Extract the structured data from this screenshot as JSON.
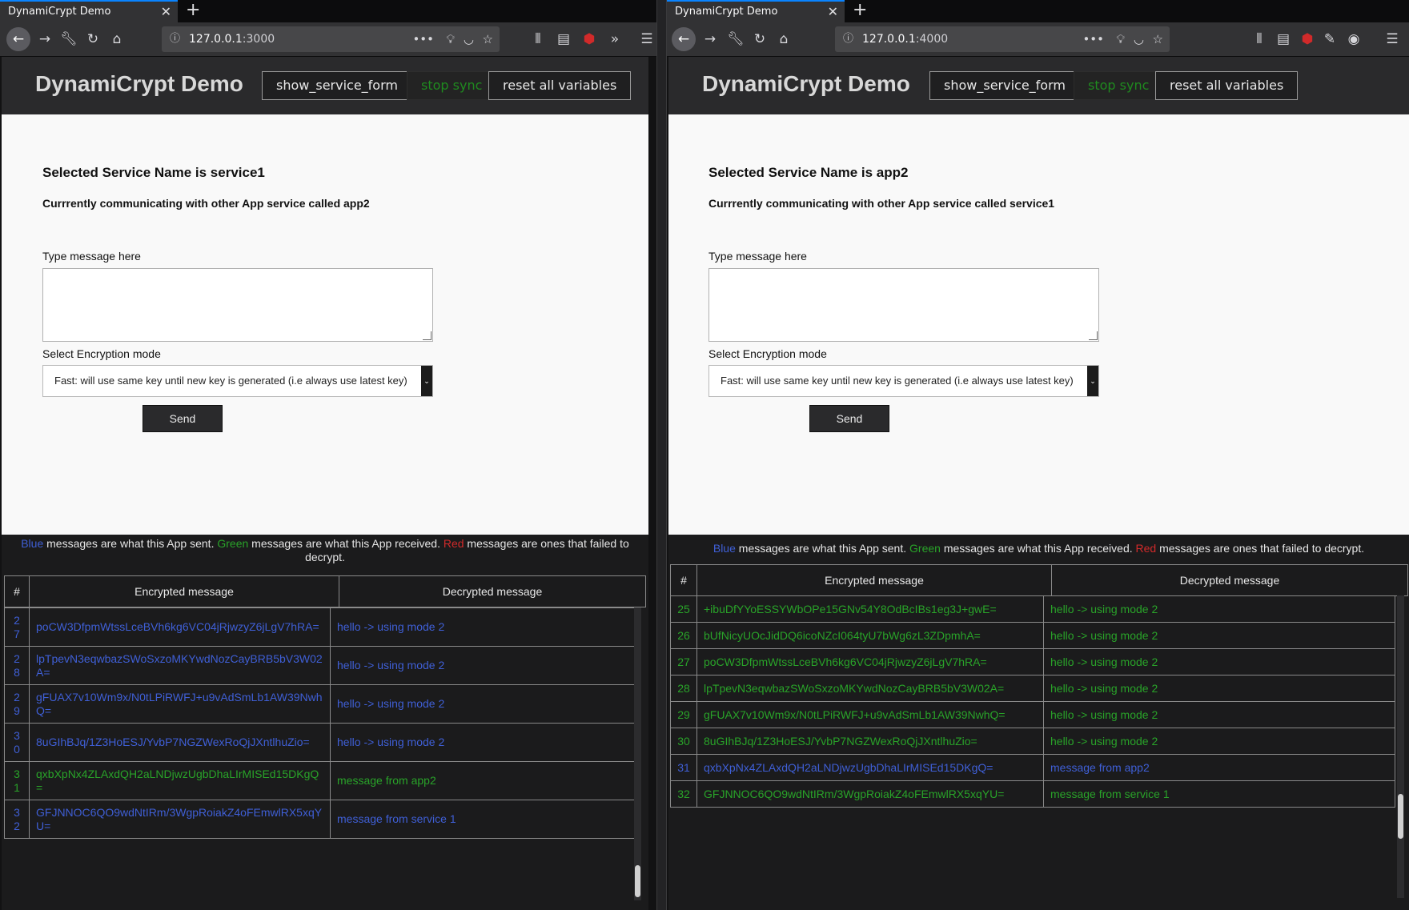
{
  "left": {
    "tab_title": "DynamiCrypt Demo",
    "url_host": "127.0.0.1",
    "url_port": ":3000",
    "app_title": "DynamiCrypt Demo",
    "buttons": {
      "show_service_form": "show_service_form",
      "stop_sync": "stop sync",
      "reset": "reset all variables"
    },
    "selected_service": "Selected Service Name is service1",
    "communicating": "Currrently communicating with other App service called app2",
    "type_label": "Type message here",
    "mode_label": "Select Encryption mode",
    "mode_value": "Fast: will use same key until new key is generated (i.e always use latest key)",
    "send_label": "Send",
    "legend": {
      "blue": "Blue",
      "t1": " messages are what this App sent. ",
      "green": "Green",
      "t2": " messages are what this App received. ",
      "red": "Red",
      "t3": " messages are ones that failed to decrypt."
    },
    "columns": [
      "#",
      "Encrypted message",
      "Decrypted message"
    ],
    "rows": [
      {
        "n": "27",
        "enc": "poCW3DfpmWtssLceBVh6kg6VC04jRjwzyZ6jLgV7hRA=",
        "dec": "hello -> using mode 2",
        "kind": "sent"
      },
      {
        "n": "28",
        "enc": "lpTpevN3eqwbazSWoSxzoMKYwdNozCayBRB5bV3W02A=",
        "dec": "hello -> using mode 2",
        "kind": "sent"
      },
      {
        "n": "29",
        "enc": "gFUAX7v10Wm9x/N0tLPiRWFJ+u9vAdSmLb1AW39NwhQ=",
        "dec": "hello -> using mode 2",
        "kind": "sent"
      },
      {
        "n": "30",
        "enc": "8uGIhBJq/1Z3HoESJ/YvbP7NGZWexRoQjJXntlhuZio=",
        "dec": "hello -> using mode 2",
        "kind": "sent"
      },
      {
        "n": "31",
        "enc": "qxbXpNx4ZLAxdQH2aLNDjwzUgbDhaLIrMISEd15DKgQ=",
        "dec": "message from app2",
        "kind": "recv"
      },
      {
        "n": "32",
        "enc": "GFJNNOC6QO9wdNtIRm/3WgpRoiakZ4oFEmwlRX5xqYU=",
        "dec": "message from service 1",
        "kind": "sent"
      }
    ]
  },
  "right": {
    "tab_title": "DynamiCrypt Demo",
    "url_host": "127.0.0.1",
    "url_port": ":4000",
    "app_title": "DynamiCrypt Demo",
    "buttons": {
      "show_service_form": "show_service_form",
      "stop_sync": "stop sync",
      "reset": "reset all variables"
    },
    "selected_service": "Selected Service Name is app2",
    "communicating": "Currrently communicating with other App service called service1",
    "type_label": "Type message here",
    "mode_label": "Select Encryption mode",
    "mode_value": "Fast: will use same key until new key is generated (i.e always use latest key)",
    "send_label": "Send",
    "legend": {
      "blue": "Blue",
      "t1": " messages are what this App sent. ",
      "green": "Green",
      "t2": " messages are what this App received. ",
      "red": "Red",
      "t3": " messages are ones that failed to decrypt."
    },
    "columns": [
      "#",
      "Encrypted message",
      "Decrypted message"
    ],
    "rows": [
      {
        "n": "25",
        "enc": "+ibuDfYYoESSYWbOPe15GNv54Y8OdBcIBs1eg3J+gwE=",
        "dec": "hello -> using mode 2",
        "kind": "recv"
      },
      {
        "n": "26",
        "enc": "bUfNicyUOcJidDQ6icoNZcI064tyU7bWg6zL3ZDpmhA=",
        "dec": "hello -> using mode 2",
        "kind": "recv"
      },
      {
        "n": "27",
        "enc": "poCW3DfpmWtssLceBVh6kg6VC04jRjwzyZ6jLgV7hRA=",
        "dec": "hello -> using mode 2",
        "kind": "recv"
      },
      {
        "n": "28",
        "enc": "lpTpevN3eqwbazSWoSxzoMKYwdNozCayBRB5bV3W02A=",
        "dec": "hello -> using mode 2",
        "kind": "recv"
      },
      {
        "n": "29",
        "enc": "gFUAX7v10Wm9x/N0tLPiRWFJ+u9vAdSmLb1AW39NwhQ=",
        "dec": "hello -> using mode 2",
        "kind": "recv"
      },
      {
        "n": "30",
        "enc": "8uGIhBJq/1Z3HoESJ/YvbP7NGZWexRoQjJXntlhuZio=",
        "dec": "hello -> using mode 2",
        "kind": "recv"
      },
      {
        "n": "31",
        "enc": "qxbXpNx4ZLAxdQH2aLNDjwzUgbDhaLIrMISEd15DKgQ=",
        "dec": "message from app2",
        "kind": "sent"
      },
      {
        "n": "32",
        "enc": "GFJNNOC6QO9wdNtIRm/3WgpRoiakZ4oFEmwlRX5xqYU=",
        "dec": "message from service 1",
        "kind": "recv"
      }
    ]
  },
  "icons": [
    "back-icon",
    "forward-icon",
    "wrench-icon",
    "reload-icon",
    "home-icon",
    "info-icon",
    "more-icon",
    "lightbulb-icon",
    "pocket-icon",
    "star-icon",
    "library-icon",
    "sidebar-icon",
    "ublock-icon",
    "overflow-icon",
    "menu-icon"
  ],
  "colors": {
    "sent": "#3f5fd6",
    "received": "#29a329",
    "failed": "#d12a2a",
    "sync_button": "#1f8a1f"
  }
}
